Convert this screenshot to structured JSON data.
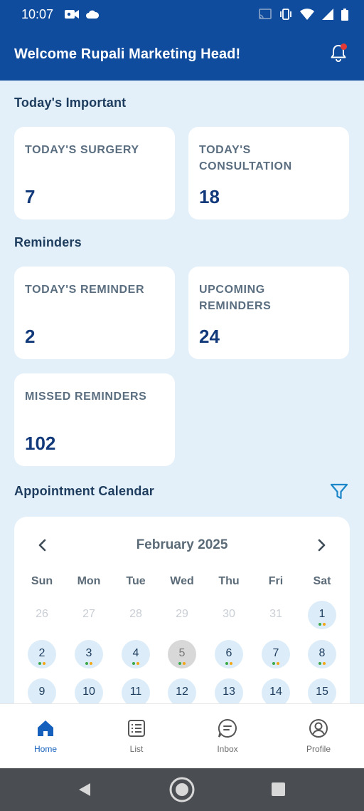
{
  "status_bar": {
    "time": "10:07"
  },
  "header": {
    "title": "Welcome Rupali Marketing Head!"
  },
  "sections": {
    "important_title": "Today's Important",
    "reminders_title": "Reminders",
    "calendar_title": "Appointment Calendar"
  },
  "important_cards": [
    {
      "label": "TODAY'S SURGERY",
      "value": "7"
    },
    {
      "label": "TODAY'S CONSULTATION",
      "value": "18"
    }
  ],
  "reminder_cards": [
    {
      "label": "TODAY'S REMINDER",
      "value": "2"
    },
    {
      "label": "UPCOMING REMINDERS",
      "value": "24"
    },
    {
      "label": "MISSED REMINDERS",
      "value": "102"
    }
  ],
  "calendar": {
    "month_label": "February 2025",
    "weekdays": [
      "Sun",
      "Mon",
      "Tue",
      "Wed",
      "Thu",
      "Fri",
      "Sat"
    ],
    "rows": [
      [
        "26",
        "27",
        "28",
        "29",
        "30",
        "31",
        "1"
      ],
      [
        "2",
        "3",
        "4",
        "5",
        "6",
        "7",
        "8"
      ],
      [
        "9",
        "10",
        "11",
        "12",
        "13",
        "14",
        "15"
      ]
    ],
    "today": "5",
    "dot_colors": [
      "#3aa84a",
      "#f2a516"
    ]
  },
  "bottom_nav": [
    {
      "label": "Home",
      "icon": "home-icon",
      "active": true
    },
    {
      "label": "List",
      "icon": "list-icon",
      "active": false
    },
    {
      "label": "Inbox",
      "icon": "chat-icon",
      "active": false
    },
    {
      "label": "Profile",
      "icon": "profile-icon",
      "active": false
    }
  ],
  "colors": {
    "header": "#0f4c9d",
    "background": "#e3f0fa",
    "accent": "#1560bd",
    "notification_badge": "#e53935"
  }
}
